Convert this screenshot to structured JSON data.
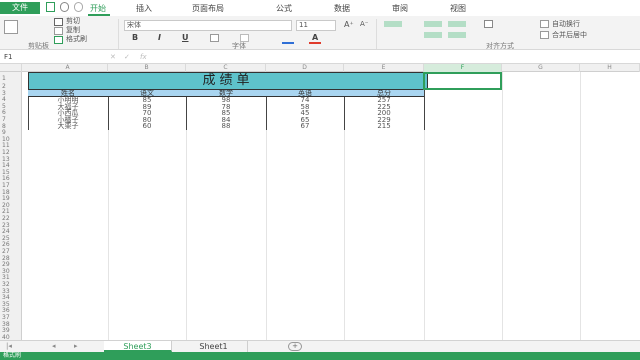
{
  "tabbar": {
    "file_label": "文件",
    "tabs": [
      "开始",
      "插入",
      "页面布局",
      "公式",
      "数据",
      "审阅",
      "视图"
    ],
    "active_tab": "开始"
  },
  "ribbon": {
    "clipboard": {
      "cut": "剪切",
      "copy": "复制",
      "format_painter": "格式刷",
      "group_label": "剪贴板"
    },
    "font": {
      "name": "宋体",
      "size": "11",
      "bold": "B",
      "italic": "I",
      "underline": "U",
      "group_label": "字体",
      "font_color": "#e03b2c",
      "fill_color": "#2f6fd6"
    },
    "alignment": {
      "wrap_text": "自动换行",
      "merge_center": "合并后居中",
      "group_label": "对齐方式"
    }
  },
  "formulabar": {
    "name_box": "F1",
    "fx": "fx"
  },
  "columns": [
    "A",
    "B",
    "C",
    "D",
    "E",
    "F",
    "G",
    "H"
  ],
  "rows": [
    "1",
    "2",
    "3",
    "4",
    "5",
    "6",
    "7",
    "8",
    "9",
    "10",
    "11",
    "12",
    "13",
    "14",
    "15",
    "16",
    "17",
    "18",
    "19",
    "20",
    "21",
    "22",
    "23",
    "24",
    "25",
    "26",
    "27",
    "28",
    "29",
    "30",
    "31",
    "32",
    "33",
    "34",
    "35",
    "36",
    "37",
    "38",
    "39",
    "40",
    "41"
  ],
  "sheet": {
    "title": "成绩单",
    "headers": [
      "姓名",
      "语文",
      "数学",
      "英语",
      "总分"
    ],
    "records": [
      [
        "小明明",
        "85",
        "98",
        "74",
        "257"
      ],
      [
        "大福子",
        "89",
        "78",
        "58",
        "225"
      ],
      [
        "小西瓜",
        "70",
        "85",
        "45",
        "200"
      ],
      [
        "小橘子",
        "80",
        "84",
        "65",
        "229"
      ],
      [
        "大栗子",
        "60",
        "88",
        "67",
        "215"
      ]
    ],
    "title_fill": "#5ec3cb",
    "header_fill": "#a9d5f0"
  },
  "sheet_tabs": {
    "tabs": [
      "Sheet3",
      "Sheet1"
    ],
    "active": "Sheet3",
    "add_label": "+"
  },
  "statusbar": {
    "text": "格式刷"
  },
  "accent_color": "#2f9e5a"
}
